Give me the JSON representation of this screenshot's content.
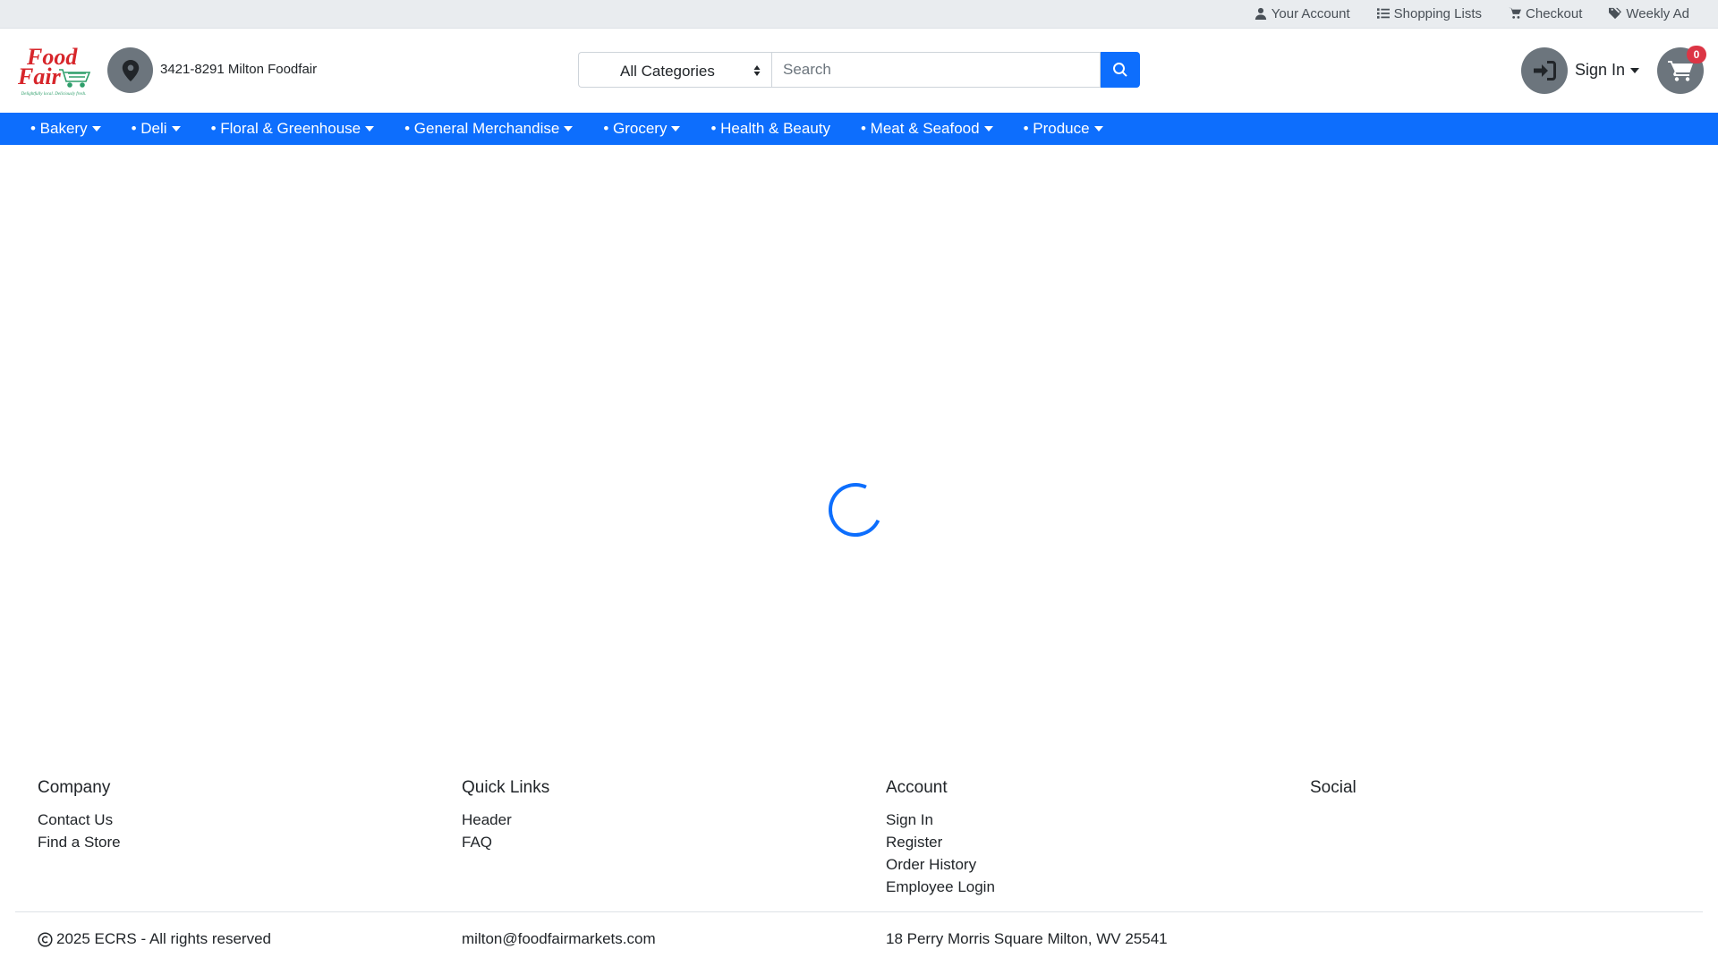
{
  "topbar": {
    "links": [
      {
        "label": "Your Account",
        "icon": "user-icon"
      },
      {
        "label": "Shopping Lists",
        "icon": "list-icon"
      },
      {
        "label": "Checkout",
        "icon": "cart-icon"
      },
      {
        "label": "Weekly Ad",
        "icon": "tags-icon"
      }
    ]
  },
  "header": {
    "logo": {
      "line1": "Food",
      "line2": "Fair",
      "tagline": "Delightfully local. Deliciously fresh."
    },
    "store_name": "3421-8291 Milton Foodfair",
    "search": {
      "category_selected": "All Categories",
      "placeholder": "Search"
    },
    "signin_label": "Sign In",
    "cart_count": "0"
  },
  "nav": {
    "items": [
      {
        "label": "• Bakery",
        "dropdown": true
      },
      {
        "label": "• Deli",
        "dropdown": true
      },
      {
        "label": "• Floral & Greenhouse",
        "dropdown": true
      },
      {
        "label": "• General Merchandise",
        "dropdown": true
      },
      {
        "label": "• Grocery",
        "dropdown": true
      },
      {
        "label": "• Health & Beauty",
        "dropdown": false
      },
      {
        "label": "• Meat & Seafood",
        "dropdown": true
      },
      {
        "label": "• Produce",
        "dropdown": true
      }
    ]
  },
  "footer": {
    "columns": [
      {
        "heading": "Company",
        "links": [
          "Contact Us",
          "Find a Store"
        ]
      },
      {
        "heading": "Quick Links",
        "links": [
          "Header",
          "FAQ"
        ]
      },
      {
        "heading": "Account",
        "links": [
          "Sign In",
          "Register",
          "Order History",
          "Employee Login"
        ]
      },
      {
        "heading": "Social",
        "links": []
      }
    ],
    "copyright": "2025 ECRS - All rights reserved",
    "email": "milton@foodfairmarkets.com",
    "address": "18 Perry Morris Square Milton, WV 25541"
  },
  "colors": {
    "primary": "#0d6efd",
    "topbar_bg": "#e9ecef",
    "icon_circle": "#6c757d",
    "badge": "#dc3545",
    "logo_red": "#d7262b",
    "logo_green": "#2e9e6a"
  }
}
